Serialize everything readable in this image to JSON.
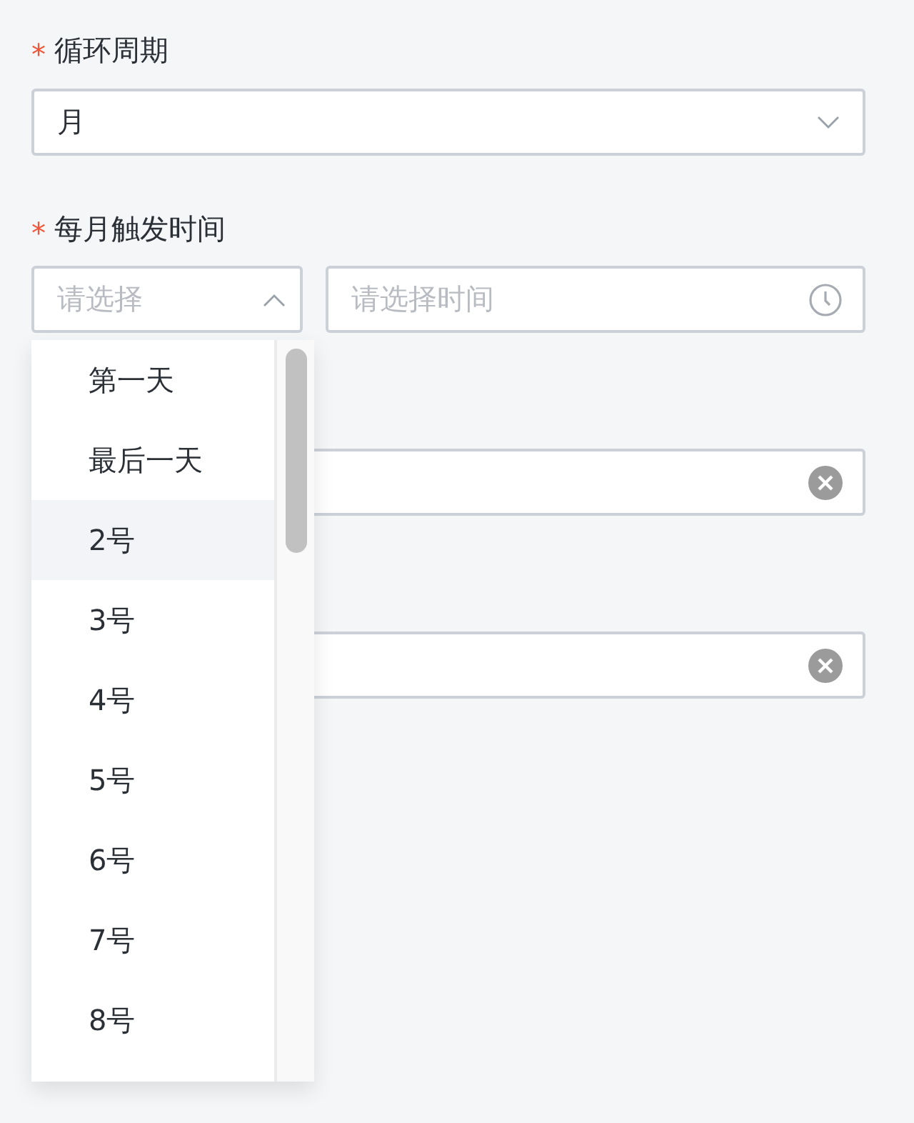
{
  "cycle": {
    "label": "循环周期",
    "required_mark": "*",
    "value": "月"
  },
  "trigger": {
    "label": "每月触发时间",
    "required_mark": "*",
    "day_select": {
      "placeholder": "请选择",
      "open": true
    },
    "time_picker": {
      "placeholder": "请选择时间"
    }
  },
  "inputs": [
    {
      "clearable": true
    },
    {
      "clearable": true
    }
  ],
  "dropdown": {
    "options": [
      {
        "label": "第一天",
        "hovered": false
      },
      {
        "label": "最后一天",
        "hovered": false
      },
      {
        "label": "2号",
        "hovered": true
      },
      {
        "label": "3号",
        "hovered": false
      },
      {
        "label": "4号",
        "hovered": false
      },
      {
        "label": "5号",
        "hovered": false
      },
      {
        "label": "6号",
        "hovered": false
      },
      {
        "label": "7号",
        "hovered": false
      },
      {
        "label": "8号",
        "hovered": false
      }
    ]
  }
}
